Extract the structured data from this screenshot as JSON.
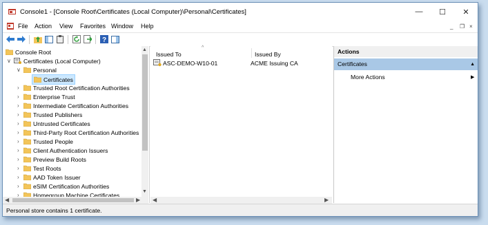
{
  "window": {
    "title": "Console1 - [Console Root\\Certificates (Local Computer)\\Personal\\Certificates]",
    "minimize_glyph": "—",
    "maximize_glyph": "☐",
    "close_glyph": "✕"
  },
  "menu": {
    "items": [
      "File",
      "Action",
      "View",
      "Favorites",
      "Window",
      "Help"
    ],
    "mdi_minimize": "_",
    "mdi_restore": "❐",
    "mdi_close": "×"
  },
  "toolbar": {
    "icons": [
      "back-arrow-icon",
      "forward-arrow-icon",
      "up-folder-icon",
      "show-hide-tree-icon",
      "clipboard-icon",
      "refresh-icon",
      "export-list-icon",
      "help-icon",
      "show-hide-action-pane-icon"
    ]
  },
  "tree": {
    "root": "Console Root",
    "computer": "Certificates (Local Computer)",
    "personal": "Personal",
    "certificates": "Certificates",
    "stores": [
      "Trusted Root Certification Authorities",
      "Enterprise Trust",
      "Intermediate Certification Authorities",
      "Trusted Publishers",
      "Untrusted Certificates",
      "Third-Party Root Certification Authorities",
      "Trusted People",
      "Client Authentication Issuers",
      "Preview Build Roots",
      "Test Roots",
      "AAD Token Issuer",
      "eSIM Certification Authorities",
      "Homegroup Machine Certificates"
    ]
  },
  "list": {
    "columns": [
      "Issued To",
      "Issued By"
    ],
    "rows": [
      {
        "issued_to": "ASC-DEMO-W10-01",
        "issued_by": "ACME Issuing CA"
      }
    ]
  },
  "actions": {
    "header": "Actions",
    "section": "Certificates",
    "items": [
      "More Actions"
    ]
  },
  "status": {
    "text": "Personal store contains 1 certificate."
  },
  "colors": {
    "selection": "#cce8ff",
    "action_section": "#a9c8e6",
    "folder": "#f3c55a"
  }
}
